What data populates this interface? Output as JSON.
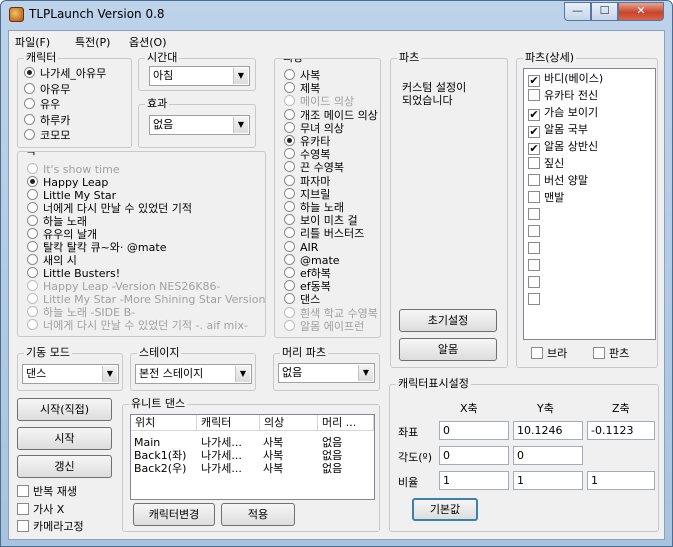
{
  "window": {
    "title": "TLPLaunch Version 0.8"
  },
  "menu": [
    "파일(F)",
    "특전(P)",
    "옵션(O)"
  ],
  "character": {
    "label": "캐릭터",
    "options": [
      "나가세_아유무",
      "아유무",
      "유우",
      "하루카",
      "코모모"
    ],
    "selected": 0
  },
  "time": {
    "label": "시간대",
    "value": "아침"
  },
  "effect": {
    "label": "효과",
    "value": "없음"
  },
  "costume": {
    "label": "의상",
    "options": [
      {
        "text": "사복",
        "enabled": true
      },
      {
        "text": "제복",
        "enabled": true
      },
      {
        "text": "메이드 의상",
        "enabled": false
      },
      {
        "text": "개조 메이드 의상",
        "enabled": true
      },
      {
        "text": "무녀 의상",
        "enabled": true
      },
      {
        "text": "유카타",
        "enabled": true
      },
      {
        "text": "수영복",
        "enabled": true
      },
      {
        "text": "끈 수영복",
        "enabled": true
      },
      {
        "text": "파자마",
        "enabled": true
      },
      {
        "text": "지브릴",
        "enabled": true
      },
      {
        "text": "하늘 노래",
        "enabled": true
      },
      {
        "text": "보이 미츠 걸",
        "enabled": true
      },
      {
        "text": "리틀 버스터즈",
        "enabled": true
      },
      {
        "text": "AIR",
        "enabled": true
      },
      {
        "text": "@mate",
        "enabled": true
      },
      {
        "text": "ef하복",
        "enabled": true
      },
      {
        "text": "ef동복",
        "enabled": true
      },
      {
        "text": "댄스",
        "enabled": true
      },
      {
        "text": "흰색 학교 수영복",
        "enabled": false
      },
      {
        "text": "알몸 에이프런",
        "enabled": false
      }
    ],
    "selected": 5
  },
  "song": {
    "label": "곡",
    "options": [
      {
        "text": "It's show time",
        "enabled": false
      },
      {
        "text": "Happy Leap",
        "enabled": true
      },
      {
        "text": "Little My Star",
        "enabled": true
      },
      {
        "text": "너에게 다시 만날 수 있었던 기적",
        "enabled": true
      },
      {
        "text": "하늘 노래",
        "enabled": true
      },
      {
        "text": "유우의 날개",
        "enabled": true
      },
      {
        "text": "탈칵 탈칵 큐~와· @mate",
        "enabled": true
      },
      {
        "text": "새의 시",
        "enabled": true
      },
      {
        "text": "Little Busters!",
        "enabled": true
      },
      {
        "text": "Happy Leap -Version NES26K86-",
        "enabled": false
      },
      {
        "text": "Little My Star -More Shining Star Version-",
        "enabled": false
      },
      {
        "text": "하늘 노래 -SIDE B-",
        "enabled": false
      },
      {
        "text": "너에게 다시 만날 수 있었던 기적 -. aif mix-",
        "enabled": false
      }
    ],
    "selected": 1
  },
  "parts_panel": {
    "label": "파츠",
    "message": "커스텀 설정이\n되었습니다",
    "reset_button": "초기설정",
    "nude_button": "알몸"
  },
  "parts_detail": {
    "label": "파츠(상세)",
    "items": [
      {
        "text": "바디(베이스)",
        "checked": true
      },
      {
        "text": "유카타 전신",
        "checked": false
      },
      {
        "text": "가슴 보이기",
        "checked": true
      },
      {
        "text": "알몸 국부",
        "checked": true
      },
      {
        "text": "알몸 상반신",
        "checked": true
      },
      {
        "text": "짚신",
        "checked": false
      },
      {
        "text": "버선 양말",
        "checked": false
      },
      {
        "text": "맨발",
        "checked": false
      },
      {
        "text": "",
        "checked": false
      },
      {
        "text": "",
        "checked": false
      },
      {
        "text": "",
        "checked": false
      },
      {
        "text": "",
        "checked": false
      },
      {
        "text": "",
        "checked": false
      },
      {
        "text": "",
        "checked": false
      }
    ],
    "bra_label": "브라",
    "panties_label": "판츠"
  },
  "motion_mode": {
    "label": "기동 모드",
    "value": "댄스"
  },
  "stage": {
    "label": "스테이지",
    "value": "본전 스테이지"
  },
  "hair_parts": {
    "label": "머리 파츠",
    "value": "없음"
  },
  "buttons": {
    "start_direct": "시작(직접)",
    "start": "시작",
    "refresh": "갱신"
  },
  "options": {
    "repeat": {
      "label": "반복 재생",
      "checked": false
    },
    "lyrics": {
      "label": "가사 X",
      "checked": false
    },
    "camera_fixed": {
      "label": "카메라고정",
      "checked": false
    }
  },
  "unit_dance": {
    "label": "유니트 댄스",
    "columns": [
      "위치",
      "캐릭터",
      "의상",
      "머리 ..."
    ],
    "rows": [
      [
        "Main",
        "나가세...",
        "사복",
        "없음"
      ],
      [
        "Back1(좌)",
        "나가세...",
        "사복",
        "없음"
      ],
      [
        "Back2(우)",
        "나가세...",
        "사복",
        "없음"
      ]
    ],
    "change_button": "캐릭터변경",
    "apply_button": "적용"
  },
  "char_display": {
    "label": "캐릭터표시설정",
    "axes": [
      "X축",
      "Y축",
      "Z축"
    ],
    "position": {
      "label": "좌표",
      "values": [
        "0",
        "10.1246",
        "-0.1123"
      ]
    },
    "angle": {
      "label": "각도(º)",
      "values": [
        "0",
        "0"
      ]
    },
    "scale": {
      "label": "비율",
      "values": [
        "1",
        "1",
        "1"
      ]
    },
    "default_button": "기본값"
  }
}
